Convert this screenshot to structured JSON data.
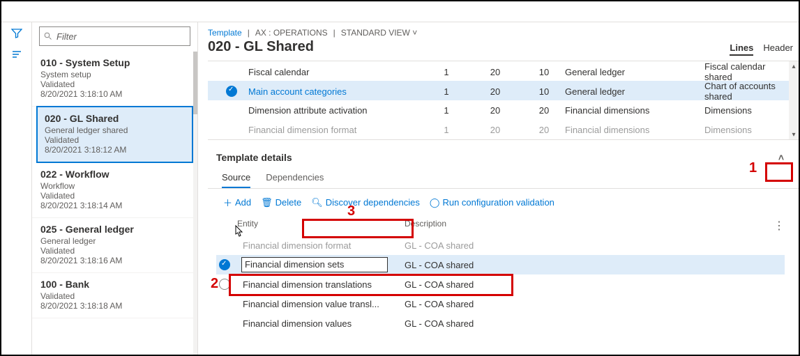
{
  "filter_placeholder": "Filter",
  "sidebar": [
    {
      "title": "010 - System Setup",
      "sub1": "System setup",
      "sub2": "Validated",
      "ts": "8/20/2021 3:18:10 AM",
      "sel": false
    },
    {
      "title": "020 - GL Shared",
      "sub1": "General ledger shared",
      "sub2": "Validated",
      "ts": "8/20/2021 3:18:12 AM",
      "sel": true
    },
    {
      "title": "022 - Workflow",
      "sub1": "Workflow",
      "sub2": "Validated",
      "ts": "8/20/2021 3:18:14 AM",
      "sel": false
    },
    {
      "title": "025 - General ledger",
      "sub1": "General ledger",
      "sub2": "Validated",
      "ts": "8/20/2021 3:18:16 AM",
      "sel": false
    },
    {
      "title": "100 - Bank",
      "sub1": "",
      "sub2": "Validated",
      "ts": "8/20/2021 3:18:18 AM",
      "sel": false
    }
  ],
  "crumb": {
    "a": "Template",
    "b": "AX : OPERATIONS",
    "c": "STANDARD VIEW"
  },
  "page_title": "020 - GL Shared",
  "right_tabs": {
    "lines": "Lines",
    "header": "Header"
  },
  "grid": [
    {
      "sel": false,
      "name": "Fiscal calendar",
      "c1": "1",
      "c2": "20",
      "c3": "10",
      "c4": "General ledger",
      "c5": "Fiscal calendar shared"
    },
    {
      "sel": true,
      "name": "Main account categories",
      "c1": "1",
      "c2": "20",
      "c3": "10",
      "c4": "General ledger",
      "c5": "Chart of accounts shared"
    },
    {
      "sel": false,
      "name": "Dimension attribute activation",
      "c1": "1",
      "c2": "20",
      "c3": "20",
      "c4": "Financial dimensions",
      "c5": "Dimensions"
    },
    {
      "sel": false,
      "name": "Financial dimension format",
      "c1": "1",
      "c2": "20",
      "c3": "20",
      "c4": "Financial dimensions",
      "c5": "Dimensions",
      "fade": true
    }
  ],
  "details_hdr": "Template details",
  "subtabs": {
    "source": "Source",
    "deps": "Dependencies"
  },
  "actions": {
    "add": "Add",
    "delete": "Delete",
    "discover": "Discover dependencies",
    "run": "Run configuration validation"
  },
  "sg_headers": {
    "entity": "Entity",
    "desc": "Description"
  },
  "sg_rows": [
    {
      "sel": false,
      "entity": "Financial dimension format",
      "desc": "GL - COA shared",
      "fade": true,
      "noradio": true
    },
    {
      "sel": true,
      "entity": "Financial dimension sets",
      "desc": "GL - COA shared"
    },
    {
      "sel": false,
      "entity": "Financial dimension translations",
      "desc": "GL - COA shared"
    },
    {
      "sel": false,
      "entity": "Financial dimension value transl...",
      "desc": "GL - COA shared",
      "noradio": true
    },
    {
      "sel": false,
      "entity": "Financial dimension values",
      "desc": "GL - COA shared",
      "noradio": true
    }
  ],
  "annot": {
    "l1": "1",
    "l2": "2",
    "l3": "3"
  }
}
